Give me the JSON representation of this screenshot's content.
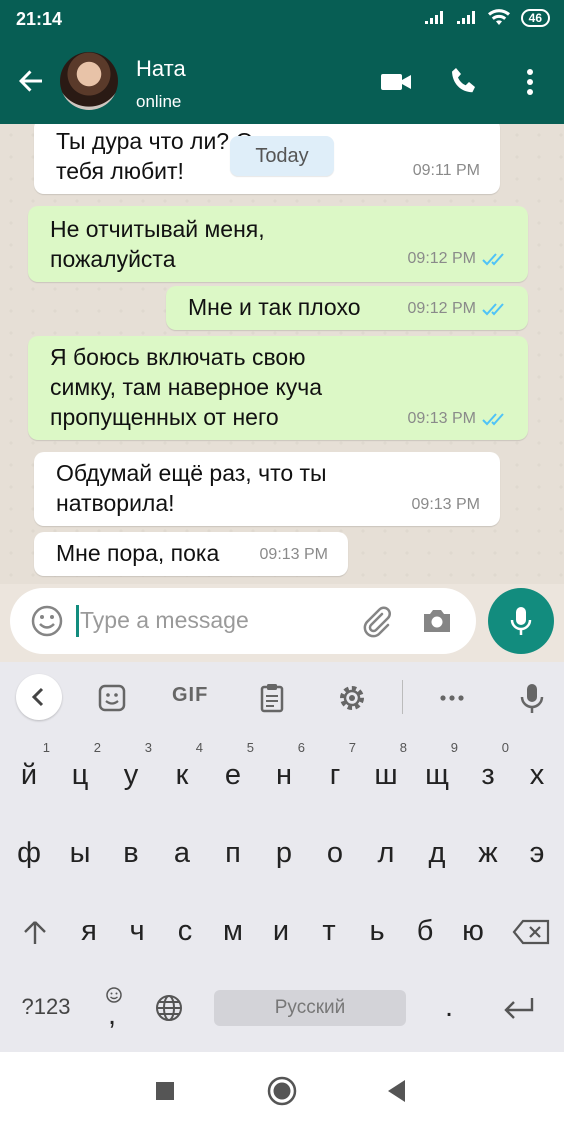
{
  "status_bar": {
    "time": "21:14",
    "battery": "46"
  },
  "header": {
    "contact_name": "Ната",
    "contact_status": "online"
  },
  "chat": {
    "date_chip": "Today",
    "messages": [
      {
        "dir": "in",
        "text": "Ты дура что ли? Он так\nтебя любит!",
        "time": "09:11 PM"
      },
      {
        "dir": "out",
        "text": "Не отчитывай меня,\nпожалуйста",
        "time": "09:12 PM",
        "read": true
      },
      {
        "dir": "out",
        "text": "Мне и так плохо",
        "time": "09:12 PM",
        "read": true
      },
      {
        "dir": "out",
        "text": "Я боюсь включать свою\nсимку, там наверное куча\nпропущенных от него",
        "time": "09:13 PM",
        "read": true
      },
      {
        "dir": "in",
        "text": "Обдумай ещё раз, что ты\nнатворила!",
        "time": "09:13 PM"
      },
      {
        "dir": "in",
        "text": "Мне пора, пока",
        "time": "09:13 PM"
      }
    ]
  },
  "input": {
    "placeholder": "Type a message"
  },
  "keyboard": {
    "toolbar": {
      "gif_label": "GIF"
    },
    "row1": [
      {
        "k": "й",
        "h": "1"
      },
      {
        "k": "ц",
        "h": "2"
      },
      {
        "k": "у",
        "h": "3"
      },
      {
        "k": "к",
        "h": "4"
      },
      {
        "k": "е",
        "h": "5"
      },
      {
        "k": "н",
        "h": "6"
      },
      {
        "k": "г",
        "h": "7"
      },
      {
        "k": "ш",
        "h": "8"
      },
      {
        "k": "щ",
        "h": "9"
      },
      {
        "k": "з",
        "h": "0"
      },
      {
        "k": "х",
        "h": ""
      }
    ],
    "row2": [
      "ф",
      "ы",
      "в",
      "а",
      "п",
      "р",
      "о",
      "л",
      "д",
      "ж",
      "э"
    ],
    "row3": [
      "я",
      "ч",
      "с",
      "м",
      "и",
      "т",
      "ь",
      "б",
      "ю"
    ],
    "row4": {
      "symbols": "?123",
      "comma": ",",
      "space": "Русский",
      "period": "."
    }
  },
  "colors": {
    "header": "#075e54",
    "accent": "#128c7e",
    "outgoing": "#dcf8c6",
    "read_ticks": "#4fc3f7"
  }
}
